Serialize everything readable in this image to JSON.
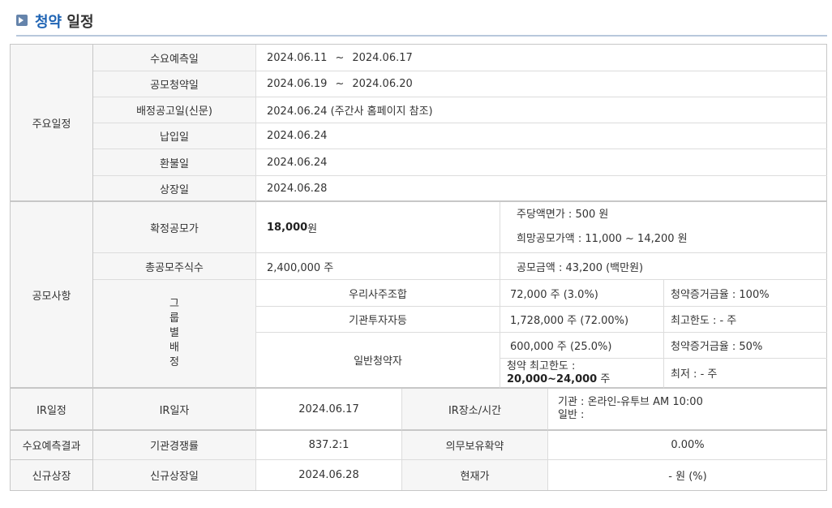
{
  "title": {
    "accent": "청약",
    "rest": " 일정"
  },
  "schedule": {
    "category": "주요일정",
    "rows": [
      {
        "label": "수요예측일",
        "start": "2024.06.11",
        "sep": "~",
        "end": "2024.06.17"
      },
      {
        "label": "공모청약일",
        "start": "2024.06.19",
        "sep": "~",
        "end": "2024.06.20"
      },
      {
        "label": "배정공고일(신문)",
        "value": "2024.06.24 (주간사 홈페이지 참조)"
      },
      {
        "label": "납입일",
        "value": "2024.06.24"
      },
      {
        "label": "환불일",
        "value": "2024.06.24"
      },
      {
        "label": "상장일",
        "value": "2024.06.28"
      }
    ]
  },
  "offering": {
    "category": "공모사항",
    "final_price_label": "확정공모가",
    "final_price_value": "18,000",
    "final_price_unit": " 원",
    "par_value": "주당액면가 :  500 원",
    "desired_price": "희망공모가액 :  11,000 ~ 14,200 원",
    "total_shares_label": "총공모주식수",
    "total_shares_value": "2,400,000 주",
    "offering_amount": "공모금액 : 43,200 (백만원)",
    "group_label_chars": [
      "그",
      "룹",
      "별",
      "배",
      "정"
    ],
    "groups": {
      "employee": {
        "name": "우리사주조합",
        "shares": "72,000 주  (3.0%)",
        "note": "청약증거금율 : 100%"
      },
      "institution": {
        "name": "기관투자자등",
        "shares": "1,728,000 주  (72.00%)",
        "note": "최고한도 :  - 주"
      },
      "general": {
        "name": "일반청약자",
        "shares": "600,000 주  (25.0%)",
        "note": "청약증거금율 : 50%",
        "max_label": "청약 최고한도 :",
        "max_value": "20,000~24,000",
        "max_unit": " 주",
        "min": "최저 :  - 주"
      }
    }
  },
  "ir": {
    "category": "IR일정",
    "date_label": "IR일자",
    "date_value": "2024.06.17",
    "place_label": "IR장소/시간",
    "place_line1": "기관 : 온라인-유투브 AM 10:00",
    "place_line2": "일반 :"
  },
  "demand": {
    "category": "수요예측결과",
    "competition_label": "기관경쟁률",
    "competition_value": "837.2:1",
    "lockup_label": "의무보유확약",
    "lockup_value": "0.00%"
  },
  "listing": {
    "category": "신규상장",
    "date_label": "신규상장일",
    "date_value": "2024.06.28",
    "price_label": "현재가",
    "price_value": "- 원 (%)"
  }
}
